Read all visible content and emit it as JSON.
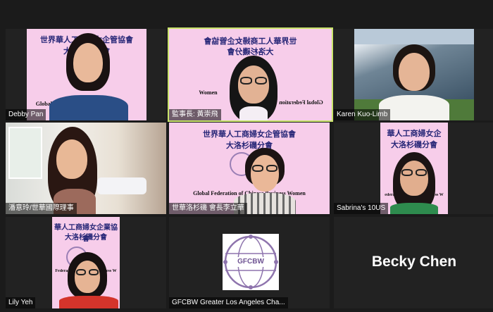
{
  "participants": [
    {
      "name": "Debby Pan"
    },
    {
      "name": "監事長: 黃崇飛"
    },
    {
      "name": "Karen Kuo-Limb"
    },
    {
      "name": "潘意玲/世華國際理事"
    },
    {
      "name": "世華洛杉磯 會長李立華"
    },
    {
      "name": "Sabrina's 10US"
    },
    {
      "name": "Lily Yeh"
    },
    {
      "name": "GFCBW Greater Los Angeles Cha..."
    },
    {
      "name": "Becky Chen"
    }
  ],
  "banner": {
    "line1": "世界華人工商婦女企管協會",
    "line2": "大洛杉磯分會",
    "english": "Global Federation of Chinese Business Women",
    "english_short": "Global Federation",
    "english_women": "Women",
    "english_great": "Great",
    "line1_short": "華人工商婦女企管協會",
    "line2_sabrina": "大洛杉磯分會",
    "lily_line1": "華人工商婦女企業協會",
    "lily_line2": "大洛杉磯分會",
    "sabrina_line1": "華人工商婦女企",
    "sabrina_en": "ederation of Chinese Business W",
    "lily_en": "Federation of Chinese Business W"
  },
  "logo_text": "GFCBW",
  "colors": {
    "background": "#1b1b1b",
    "active_border": "#c9e46b",
    "banner_pink": "#f7cdea",
    "banner_text": "#262677"
  }
}
